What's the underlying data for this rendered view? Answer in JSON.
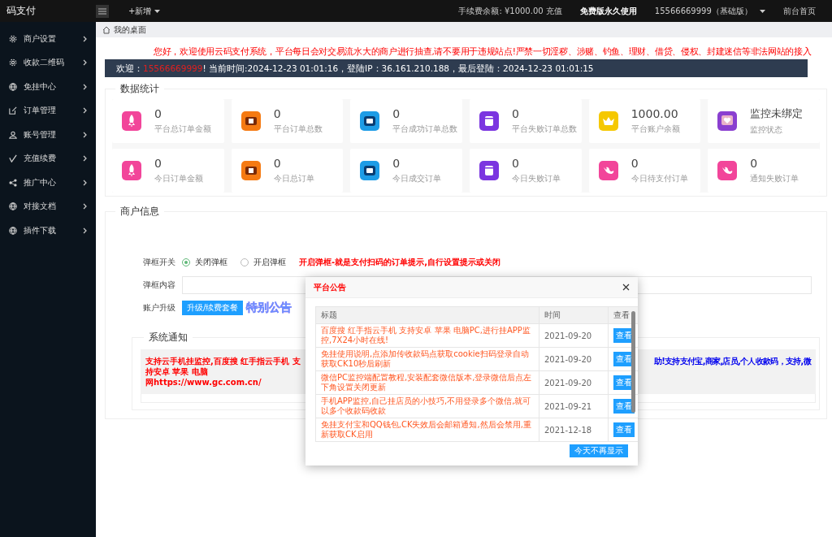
{
  "topbar": {
    "logo": "码支付",
    "new_menu": "+新增",
    "fee_balance": "手续费余额: ¥1000.00 充值",
    "plan": "免费版永久使用",
    "account": "15566669999（基础版）",
    "home_link": "前台首页"
  },
  "sidebar": {
    "items": [
      {
        "label": "商户设置",
        "kind": "gear"
      },
      {
        "label": "收款二维码",
        "kind": "gear"
      },
      {
        "label": "免挂中心",
        "kind": "globe"
      },
      {
        "label": "订单管理",
        "kind": "edit"
      },
      {
        "label": "账号管理",
        "kind": "user"
      },
      {
        "label": "充值续费",
        "kind": "check"
      },
      {
        "label": "推广中心",
        "kind": "share"
      },
      {
        "label": "对接文档",
        "kind": "globe"
      },
      {
        "label": "插件下载",
        "kind": "globe"
      }
    ]
  },
  "breadcrumb": "我的桌面",
  "marquee": "您好，欢迎使用云码支付系统，平台每日会对交易流水大的商户进行抽查,请不要用于违规站点!严禁一切淫秽、涉赌、钓鱼、理财、借贷、侵权、封建迷信等非法网站的接入",
  "welcome": {
    "prefix": "欢迎：",
    "user": "15566669999",
    "info": "! 当前时间:2024-12-23 01:01:16，登陆IP：36.161.210.188，最后登陆：2024-12-23 01:01:15"
  },
  "stats": {
    "title": "数据统计",
    "cards": [
      {
        "value": "0",
        "label": "平台总订单金额",
        "kind": "rocket",
        "color": "#f2459a"
      },
      {
        "value": "0",
        "label": "平台订单总数",
        "kind": "ticket",
        "color": "#f57a12"
      },
      {
        "value": "0",
        "label": "平台成功订单总数",
        "kind": "card",
        "color": "#1d9ce6"
      },
      {
        "value": "0",
        "label": "平台失败订单总数",
        "kind": "box",
        "color": "#7b35e0"
      },
      {
        "value": "1000.00",
        "label": "平台账户余额",
        "kind": "crown",
        "color": "#f5c800"
      },
      {
        "value": "监控未绑定",
        "label": "监控状态",
        "kind": "heart",
        "color": "#8a3fd0"
      },
      {
        "value": "0",
        "label": "今日订单金额",
        "kind": "rocket",
        "color": "#f2459a"
      },
      {
        "value": "0",
        "label": "今日总订单",
        "kind": "ticket",
        "color": "#f57a12"
      },
      {
        "value": "0",
        "label": "今日成交订单",
        "kind": "card",
        "color": "#1d9ce6"
      },
      {
        "value": "0",
        "label": "今日失败订单",
        "kind": "box",
        "color": "#7b35e0"
      },
      {
        "value": "0",
        "label": "今日待支付订单",
        "kind": "bird",
        "color": "#f2459a"
      },
      {
        "value": "0",
        "label": "通知失败订单",
        "kind": "bird",
        "color": "#f2459a"
      }
    ]
  },
  "merchant": {
    "title": "商户信息",
    "popup_switch": {
      "label": "弹框开关",
      "options": [
        {
          "label": "关闭弹框",
          "selected": true
        },
        {
          "label": "开启弹框",
          "selected": false
        }
      ],
      "hint": "开启弹框-就是支付扫码的订单提示,自行设置提示或关闭"
    },
    "popup_content": {
      "label": "弹框内容"
    },
    "upgrade": {
      "label": "账户升级",
      "button": "升级/续费套餐",
      "special": "特别公告"
    },
    "notice": {
      "title": "系统通知",
      "left_text": "支持云手机挂监控,百度搜 红手指云手机 支持安卓 苹果 电脑",
      "left_line2": "网https://www.gc.com.cn/",
      "right_text": "助!支持支付宝,商家,店员,个人收款码，支持,微"
    }
  },
  "modal": {
    "title": "平台公告",
    "columns": [
      "标题",
      "时间",
      "查看"
    ],
    "rows": [
      {
        "title": "百度搜 红手指云手机 支持安卓 苹果 电脑PC,进行挂APP监控,7X24小时在线!",
        "time": "2021-09-20",
        "action": "查看"
      },
      {
        "title": "免挂使用说明,点添加传收款码点获取cookie扫码登录自动获取CK10秒后刷新",
        "time": "2021-09-20",
        "action": "查看"
      },
      {
        "title": "微信PC监控端配置教程,安装配套微信版本,登录微信后点左下角设置关闭更新",
        "time": "2021-09-20",
        "action": "查看"
      },
      {
        "title": "手机APP监控,自己挂店员的小技巧,不用登录多个微信,就可以多个收款码收款",
        "time": "2021-09-21",
        "action": "查看"
      },
      {
        "title": "免挂支付宝和QQ钱包,CK失效后会邮箱通知,然后会禁用,重新获取CK启用",
        "time": "2021-12-18",
        "action": "查看"
      }
    ],
    "footer_button": "今天不再显示"
  }
}
